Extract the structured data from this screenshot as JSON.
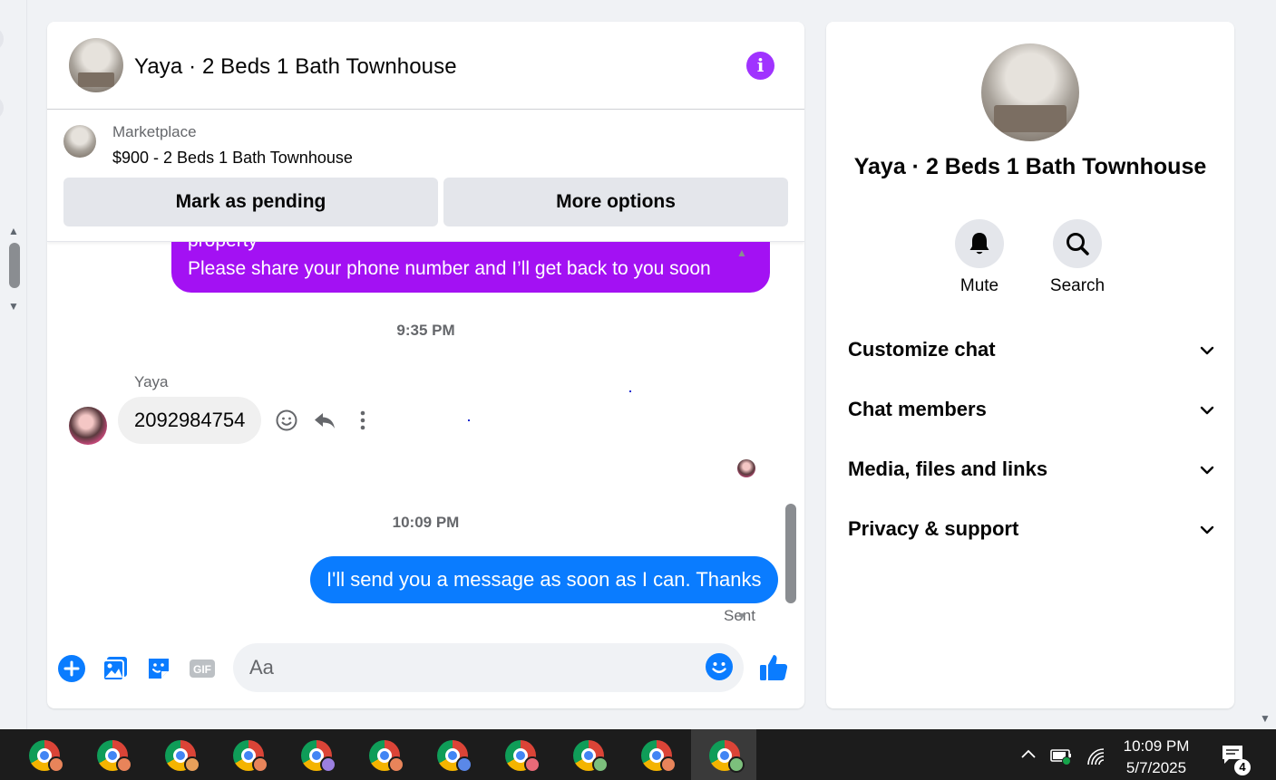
{
  "chat": {
    "title": "Yaya · 2 Beds 1 Bath Townhouse",
    "listing": {
      "label": "Marketplace",
      "title": "$900 - 2 Beds 1 Bath Townhouse",
      "mark_pending": "Mark as pending",
      "more_options": "More options"
    },
    "messages": {
      "outgoing_1_line1": "property",
      "outgoing_1_line2": "Please share your phone number and I’ll get back to you soon",
      "timestamp_1": "9:35 PM",
      "sender_name": "Yaya",
      "incoming_1": "2092984754",
      "timestamp_2": "10:09 PM",
      "outgoing_2": "I'll send you a message as soon as I can. Thanks",
      "status": "Sent"
    },
    "composer": {
      "placeholder": "Aa",
      "gif_label": "GIF"
    }
  },
  "details": {
    "title": "Yaya · 2 Beds 1 Bath Townhouse",
    "actions": [
      {
        "label": "Mute",
        "icon": "bell-icon"
      },
      {
        "label": "Search",
        "icon": "search-icon"
      }
    ],
    "sections": [
      {
        "label": "Customize chat"
      },
      {
        "label": "Chat members"
      },
      {
        "label": "Media, files and links"
      },
      {
        "label": "Privacy & support"
      }
    ]
  },
  "taskbar": {
    "time": "10:09 PM",
    "date": "5/7/2025",
    "notification_count": "4",
    "app_badges": [
      "#e8845a",
      "#e8845a",
      "#e8a05a",
      "#e8845a",
      "#9b7fe0",
      "#e8845a",
      "#5a88e8",
      "#e86a78",
      "#7cbf7c",
      "#e8845a",
      "#7cbf7c"
    ]
  },
  "colors": {
    "messenger_purple": "#a311f3",
    "messenger_blue": "#0a7cff",
    "info_purple": "#a033ff"
  }
}
